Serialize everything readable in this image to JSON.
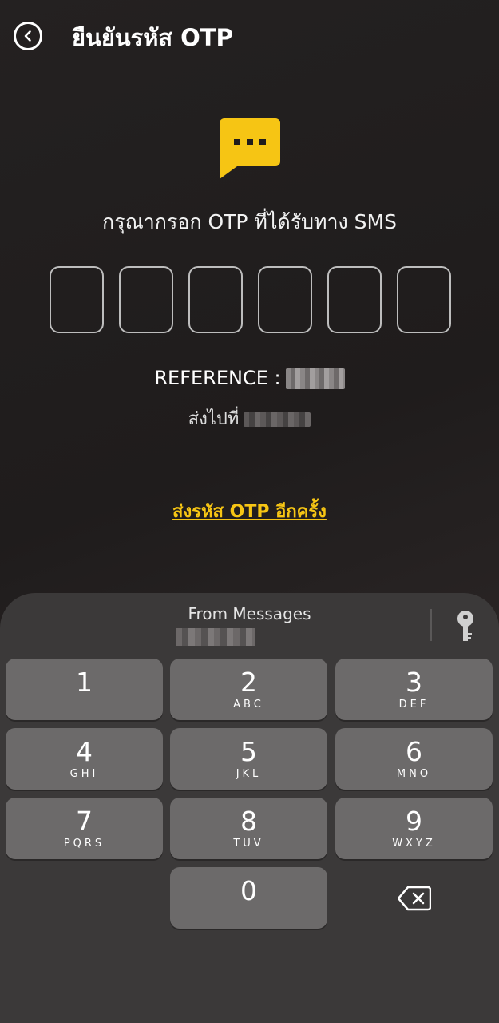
{
  "header": {
    "title": "ยืนยันรหัส OTP",
    "back_icon": "chevron-left-circle-icon"
  },
  "main": {
    "icon": "sms-chat-bubble-icon",
    "prompt": "กรุณากรอก OTP ที่ได้รับทาง SMS",
    "otp_digits": [
      "",
      "",
      "",
      "",
      "",
      ""
    ],
    "reference_label": "REFERENCE :",
    "sent_to_label": "ส่งไปที่",
    "resend_link": "ส่งรหัส OTP อีกครั้ง"
  },
  "keyboard": {
    "suggestion_label": "From Messages",
    "password_icon": "key-icon",
    "delete_icon": "backspace-icon",
    "keys": [
      {
        "num": "1",
        "letters": ""
      },
      {
        "num": "2",
        "letters": "ABC"
      },
      {
        "num": "3",
        "letters": "DEF"
      },
      {
        "num": "4",
        "letters": "GHI"
      },
      {
        "num": "5",
        "letters": "JKL"
      },
      {
        "num": "6",
        "letters": "MNO"
      },
      {
        "num": "7",
        "letters": "PQRS"
      },
      {
        "num": "8",
        "letters": "TUV"
      },
      {
        "num": "9",
        "letters": "WXYZ"
      },
      {
        "num": "0",
        "letters": ""
      }
    ]
  },
  "colors": {
    "accent": "#F6C514",
    "background": "#1F1C1C",
    "keyboard_bg": "#3B3939",
    "key_bg": "#6C6A6A"
  }
}
